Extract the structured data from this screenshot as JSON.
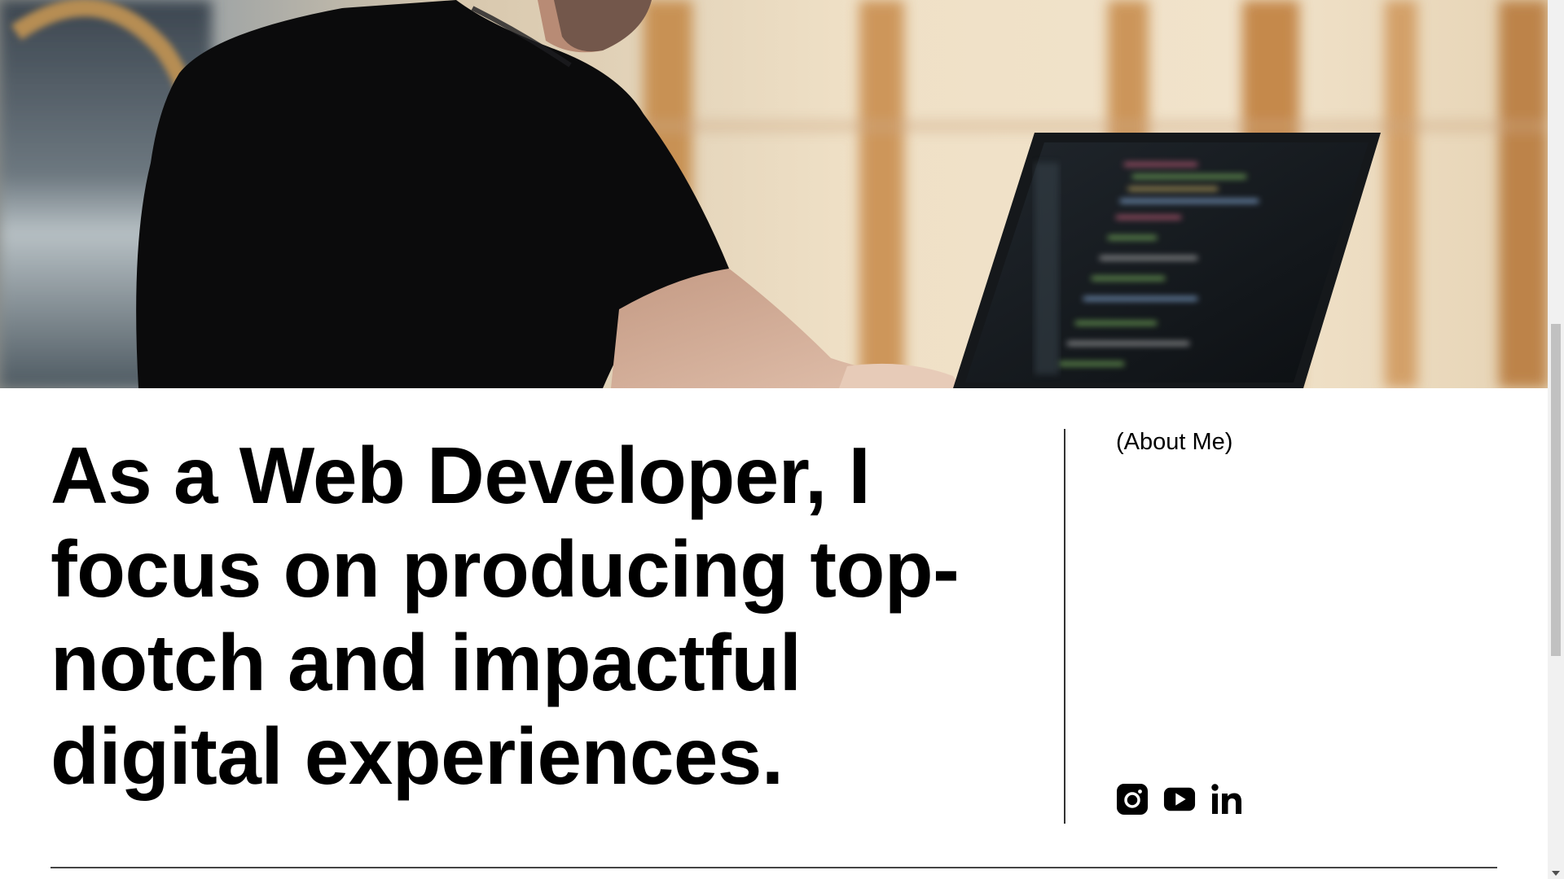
{
  "hero": {
    "image": "person-coding-on-laptop"
  },
  "about": {
    "headline": "As a Web Developer, I focus on producing top-notch and impactful digital experiences.",
    "section_label": "(About Me)"
  },
  "socials": [
    {
      "icon": "instagram-icon"
    },
    {
      "icon": "youtube-icon"
    },
    {
      "icon": "linkedin-icon",
      "label": "in"
    }
  ],
  "colors": {
    "text": "#000000",
    "background": "#ffffff",
    "divider": "#333333"
  }
}
